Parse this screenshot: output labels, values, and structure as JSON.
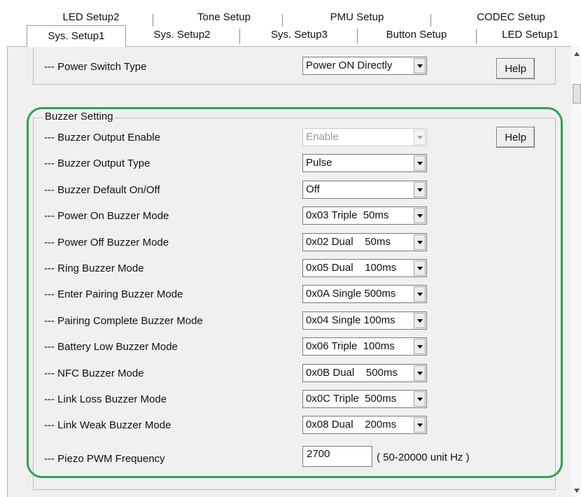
{
  "tabs_row1": [
    "LED Setup2",
    "Tone Setup",
    "PMU Setup",
    "CODEC Setup"
  ],
  "tabs_row2": [
    "Sys. Setup1",
    "Sys. Setup2",
    "Sys. Setup3",
    "Button Setup",
    "LED Setup1"
  ],
  "power": {
    "label": "--- Power Switch Type",
    "value": "Power ON Directly",
    "help": "Help"
  },
  "buzzer": {
    "group_title": "Buzzer Setting",
    "help": "Help",
    "rows": [
      {
        "label": "--- Buzzer Output Enable",
        "value": "Enable",
        "disabled": true
      },
      {
        "label": "--- Buzzer Output Type",
        "value": "Pulse"
      },
      {
        "label": "--- Buzzer Default On/Off",
        "value": "Off"
      },
      {
        "label": "--- Power On Buzzer Mode",
        "value": "0x03 Triple  50ms"
      },
      {
        "label": "--- Power Off Buzzer Mode",
        "value": "0x02 Dual    50ms"
      },
      {
        "label": "--- Ring Buzzer Mode",
        "value": "0x05 Dual    100ms"
      },
      {
        "label": "--- Enter Pairing Buzzer Mode",
        "value": "0x0A Single 500ms"
      },
      {
        "label": "--- Pairing Complete Buzzer Mode",
        "value": "0x04 Single 100ms"
      },
      {
        "label": "--- Battery Low Buzzer Mode",
        "value": "0x06 Triple  100ms"
      },
      {
        "label": "--- NFC Buzzer Mode",
        "value": "0x0B Dual    500ms"
      },
      {
        "label": "--- Link Loss Buzzer Mode",
        "value": "0x0C Triple  500ms"
      },
      {
        "label": "--- Link Weak Buzzer Mode",
        "value": "0x08 Dual    200ms"
      }
    ],
    "piezo": {
      "label": "--- Piezo PWM Frequency",
      "value": "2700",
      "unit": "( 50-20000 unit Hz )"
    }
  },
  "colors": {
    "highlight": "#2ea44f",
    "panel": "#f0f0f0"
  }
}
